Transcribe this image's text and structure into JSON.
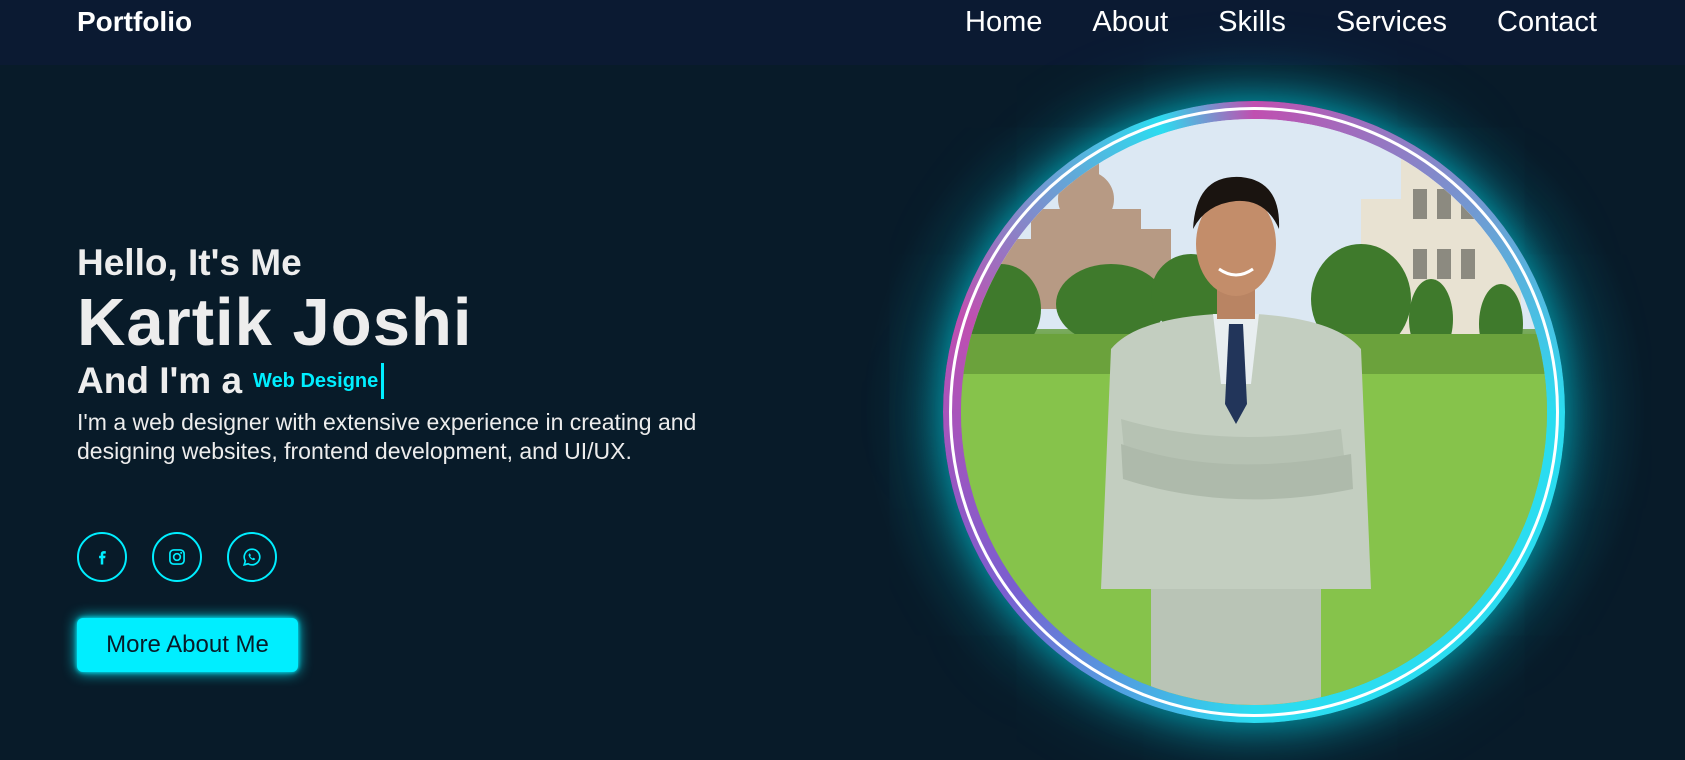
{
  "header": {
    "logo": "Portfolio",
    "nav": [
      {
        "label": "Home"
      },
      {
        "label": "About"
      },
      {
        "label": "Skills"
      },
      {
        "label": "Services"
      },
      {
        "label": "Contact"
      }
    ]
  },
  "hero": {
    "greeting": "Hello, It's Me",
    "name": "Kartik Joshi",
    "role_prefix": "And I'm a",
    "role_typed": "Web Designe",
    "bio": "I'm a web designer with extensive experience in creating and designing websites, frontend development, and UI/UX."
  },
  "social": [
    {
      "icon": "facebook-icon"
    },
    {
      "icon": "instagram-icon"
    },
    {
      "icon": "whatsapp-icon"
    }
  ],
  "cta": {
    "label": "More About Me"
  },
  "colors": {
    "background": "#081b29",
    "header": "#0b1a32",
    "accent": "#00eeff",
    "text": "#ededed",
    "ring_pink": "#c04fb0"
  }
}
